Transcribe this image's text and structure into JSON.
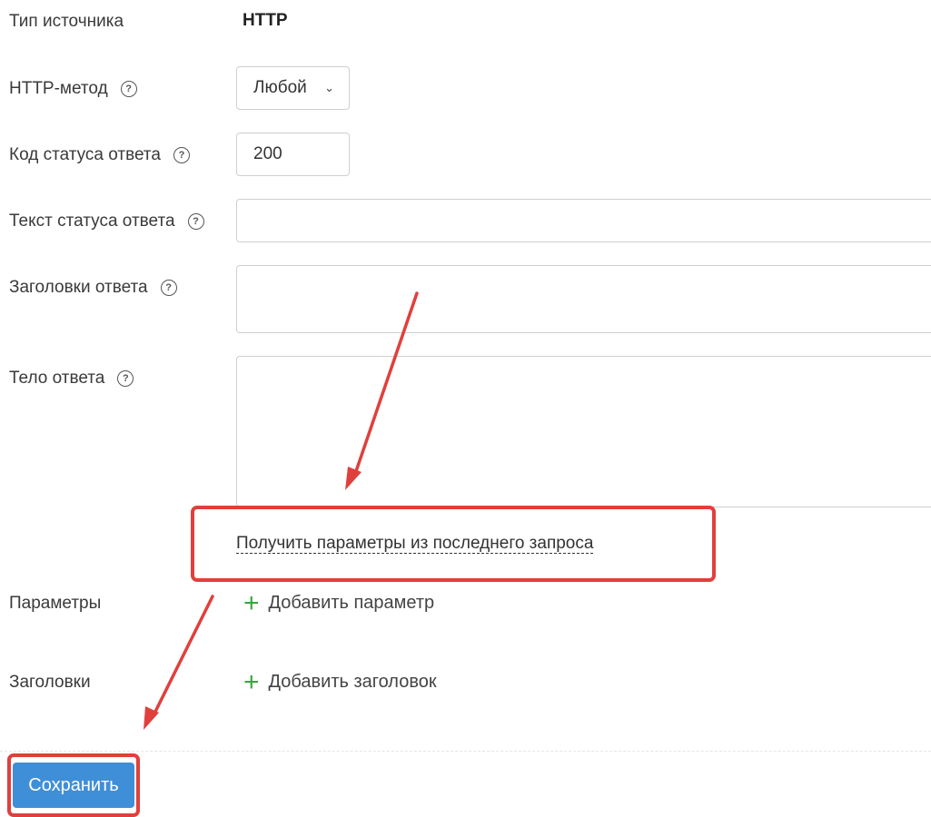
{
  "form": {
    "source_type": {
      "label": "Тип источника",
      "value": "HTTP"
    },
    "http_method": {
      "label": "HTTP-метод",
      "value": "Любой"
    },
    "status_code": {
      "label": "Код статуса ответа",
      "value": "200"
    },
    "status_text": {
      "label": "Текст статуса ответа",
      "value": ""
    },
    "response_headers": {
      "label": "Заголовки ответа",
      "value": ""
    },
    "response_body": {
      "label": "Тело ответа",
      "value": ""
    },
    "get_params_link": "Получить параметры из последнего запроса",
    "params": {
      "label": "Параметры",
      "add_label": "Добавить параметр"
    },
    "headers": {
      "label": "Заголовки",
      "add_label": "Добавить заголовок"
    },
    "save_label": "Сохранить"
  },
  "icons": {
    "help": "question-circle-icon",
    "chevron": "chevron-down-icon",
    "plus": "plus-icon"
  },
  "colors": {
    "accent": "#3f8fd8",
    "annotation": "#e0403c",
    "add_icon": "#3aa63a"
  }
}
